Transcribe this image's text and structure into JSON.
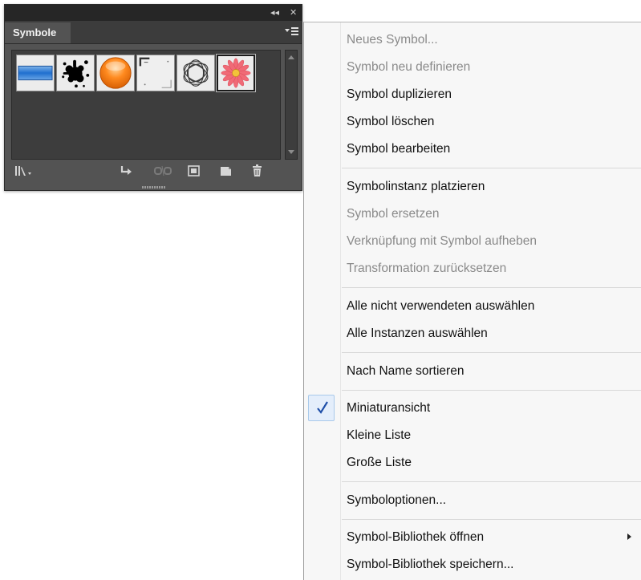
{
  "panel": {
    "tab_label": "Symbole",
    "collapse_glyph": "◂◂",
    "close_glyph": "✕",
    "symbols": [
      {
        "name": "Blue gradient banner",
        "icon": "blue-banner-icon"
      },
      {
        "name": "Ink splatter",
        "icon": "ink-splatter-icon"
      },
      {
        "name": "Orange button",
        "icon": "orange-button-icon"
      },
      {
        "name": "Corner frame",
        "icon": "corner-frame-icon"
      },
      {
        "name": "Wreath ring",
        "icon": "wreath-icon"
      },
      {
        "name": "Pink daisy",
        "icon": "daisy-icon"
      }
    ],
    "toolbar_icons": [
      "symbol-libraries-menu-icon",
      "place-symbol-instance-icon",
      "break-link-icon",
      "symbol-options-icon",
      "new-symbol-icon",
      "delete-symbol-icon"
    ]
  },
  "menu": {
    "items": [
      {
        "label": "Neues Symbol...",
        "enabled": false
      },
      {
        "label": "Symbol neu definieren",
        "enabled": false
      },
      {
        "label": "Symbol duplizieren",
        "enabled": true
      },
      {
        "label": "Symbol löschen",
        "enabled": true
      },
      {
        "label": "Symbol bearbeiten",
        "enabled": true
      },
      {
        "label": "Symbolinstanz platzieren",
        "enabled": true
      },
      {
        "label": "Symbol ersetzen",
        "enabled": false
      },
      {
        "label": "Verknüpfung mit Symbol aufheben",
        "enabled": false
      },
      {
        "label": "Transformation zurücksetzen",
        "enabled": false
      },
      {
        "label": "Alle nicht verwendeten auswählen",
        "enabled": true
      },
      {
        "label": "Alle Instanzen auswählen",
        "enabled": true
      },
      {
        "label": "Nach Name sortieren",
        "enabled": true
      },
      {
        "label": "Miniaturansicht",
        "enabled": true,
        "checked": true
      },
      {
        "label": "Kleine Liste",
        "enabled": true
      },
      {
        "label": "Große Liste",
        "enabled": true
      },
      {
        "label": "Symboloptionen...",
        "enabled": true
      },
      {
        "label": "Symbol-Bibliothek öffnen",
        "enabled": true,
        "submenu": true
      },
      {
        "label": "Symbol-Bibliothek speichern...",
        "enabled": true
      }
    ]
  },
  "colors": {
    "panel_bg": "#535353",
    "menu_bg": "#f7f7f7",
    "disabled_text": "#8a8a8a",
    "check_accent": "#1f4fa8"
  }
}
